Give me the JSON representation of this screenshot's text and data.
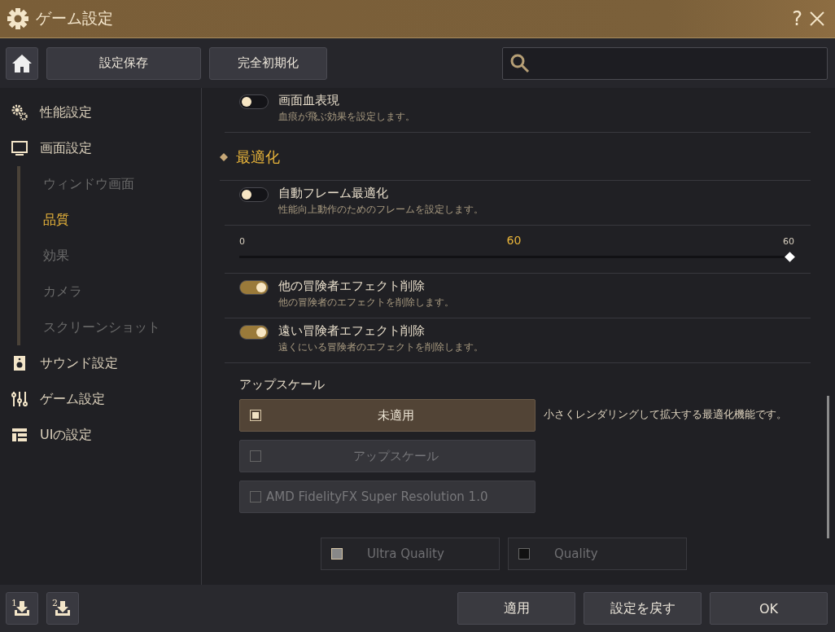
{
  "window": {
    "title": "ゲーム設定",
    "help": "?"
  },
  "toolbar": {
    "buttons": [
      "設定保存",
      "完全初期化"
    ]
  },
  "sidebar": {
    "items": [
      {
        "label": "性能設定",
        "selected": false
      },
      {
        "label": "画面設定",
        "selected": false,
        "children": [
          {
            "label": "ウィンドウ画面",
            "selected": false
          },
          {
            "label": "品質",
            "selected": true
          },
          {
            "label": "効果",
            "selected": false
          },
          {
            "label": "カメラ",
            "selected": false
          },
          {
            "label": "スクリーンショット",
            "selected": false
          }
        ]
      },
      {
        "label": "サウンド設定",
        "selected": false
      },
      {
        "label": "ゲーム設定",
        "selected": false
      },
      {
        "label": "UIの設定",
        "selected": false
      }
    ]
  },
  "settings": [
    {
      "kind": "toggle",
      "title": "画面血表現",
      "description": "血痕が飛ぶ効果を設定します。",
      "on": false
    },
    {
      "kind": "section",
      "title": "最適化"
    },
    {
      "kind": "toggle",
      "title": "自動フレーム最適化",
      "description": "性能向上動作のためのフレームを設定します。",
      "on": false
    },
    {
      "kind": "slider",
      "min": "0",
      "value": "60",
      "max": "60",
      "level": 1
    },
    {
      "kind": "toggle",
      "title": "他の冒険者エフェクト削除",
      "description": "他の冒険者のエフェクトを削除します。",
      "on": true
    },
    {
      "kind": "toggle",
      "title": "遠い冒険者エフェクト削除",
      "description": "遠くにいる冒険者のエフェクトを削除します。",
      "on": true
    },
    {
      "kind": "options",
      "title": "アップスケール",
      "description": "小さくレンダリングして拡大する最適化機能です。",
      "options": [
        {
          "label": "未適用",
          "selected": true,
          "disabled": false
        },
        {
          "label": "アップスケール",
          "selected": false,
          "disabled": true
        },
        {
          "label": "AMD FidelityFX Super Resolution 1.0",
          "selected": false,
          "disabled": true
        }
      ],
      "sub_options": [
        {
          "label": "Ultra Quality",
          "selected": true
        },
        {
          "label": "Quality",
          "selected": false
        }
      ]
    }
  ],
  "footer": {
    "presets": [
      "1",
      "2"
    ],
    "buttons": [
      "適用",
      "設定を戻す",
      "OK"
    ]
  }
}
